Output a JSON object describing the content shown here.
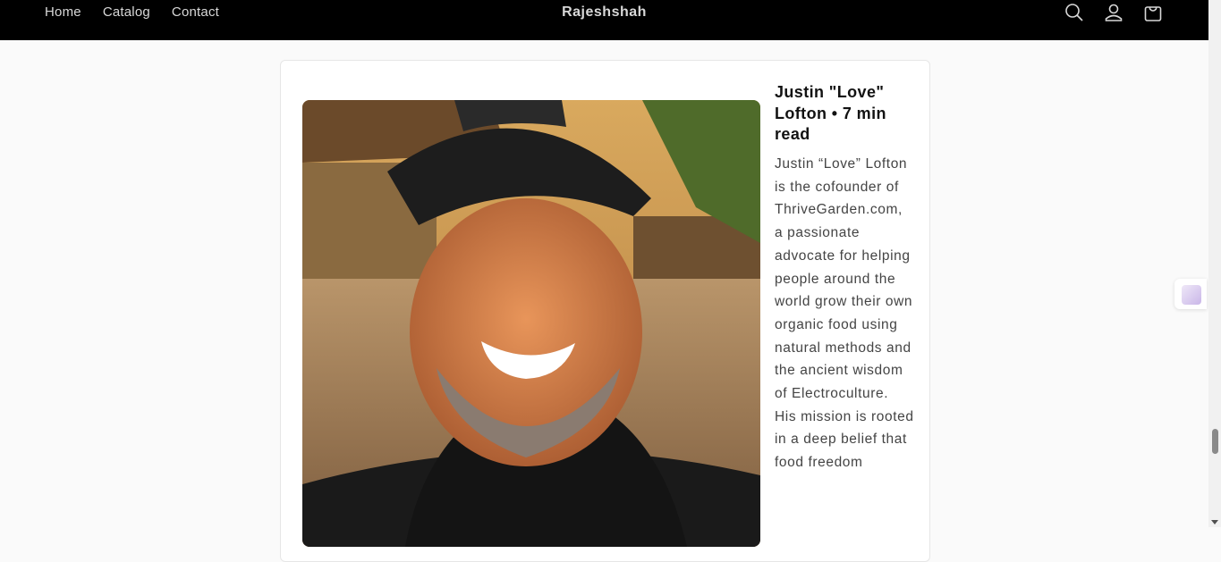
{
  "header": {
    "nav": [
      "Home",
      "Catalog",
      "Contact"
    ],
    "brand": "Rajeshshah",
    "icons": [
      "search-icon",
      "account-icon",
      "cart-icon"
    ]
  },
  "article": {
    "title": "Justin \"Love\" Lofton • 7 min read",
    "bio": "Justin “Love” Lofton is the cofounder of ThriveGarden.com, a passionate advocate for helping people around the world grow their own organic food using natural methods and the ancient wisdom of Electroculture. His mission is rooted in a deep belief that food freedom"
  },
  "colors": {
    "header_bg": "#000000",
    "page_bg": "#fafafa",
    "card_bg": "#ffffff",
    "title_text": "#121212",
    "body_text": "#444444"
  }
}
